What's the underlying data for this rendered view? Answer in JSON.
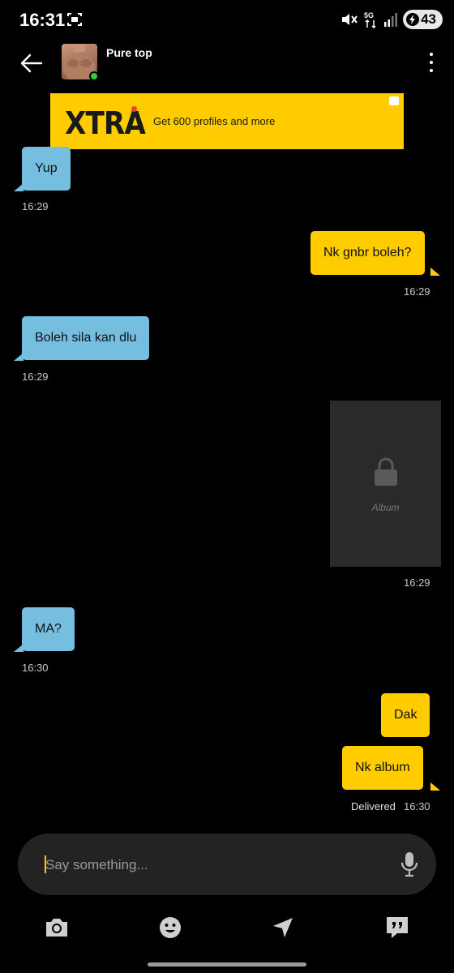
{
  "status_bar": {
    "time": "16:31",
    "battery_level": "43"
  },
  "header": {
    "contact_name": "Pure top",
    "online": true
  },
  "ad": {
    "logo": "XTRA",
    "text": "Get 600 profiles and more"
  },
  "messages": [
    {
      "direction": "in",
      "text": "Yup",
      "time": "16:29"
    },
    {
      "direction": "out",
      "text": "Nk gnbr boleh?",
      "time": "16:29"
    },
    {
      "direction": "in",
      "text": "Boleh sila kan dlu",
      "time": "16:29"
    },
    {
      "direction": "out",
      "type": "album",
      "label": "Album",
      "time": "16:29"
    },
    {
      "direction": "in",
      "text": "MA?",
      "time": "16:30"
    },
    {
      "direction": "out",
      "text": "Dak"
    },
    {
      "direction": "out",
      "text": "Nk album",
      "status": "Delivered",
      "time": "16:30"
    }
  ],
  "input": {
    "placeholder": "Say something..."
  },
  "toolbar": {
    "icons": [
      "camera-icon",
      "emoji-icon",
      "location-icon",
      "saved-phrases-icon"
    ]
  },
  "colors": {
    "incoming_bubble": "#75bedf",
    "outgoing_bubble": "#ffcc00",
    "online": "#2ecc40"
  }
}
